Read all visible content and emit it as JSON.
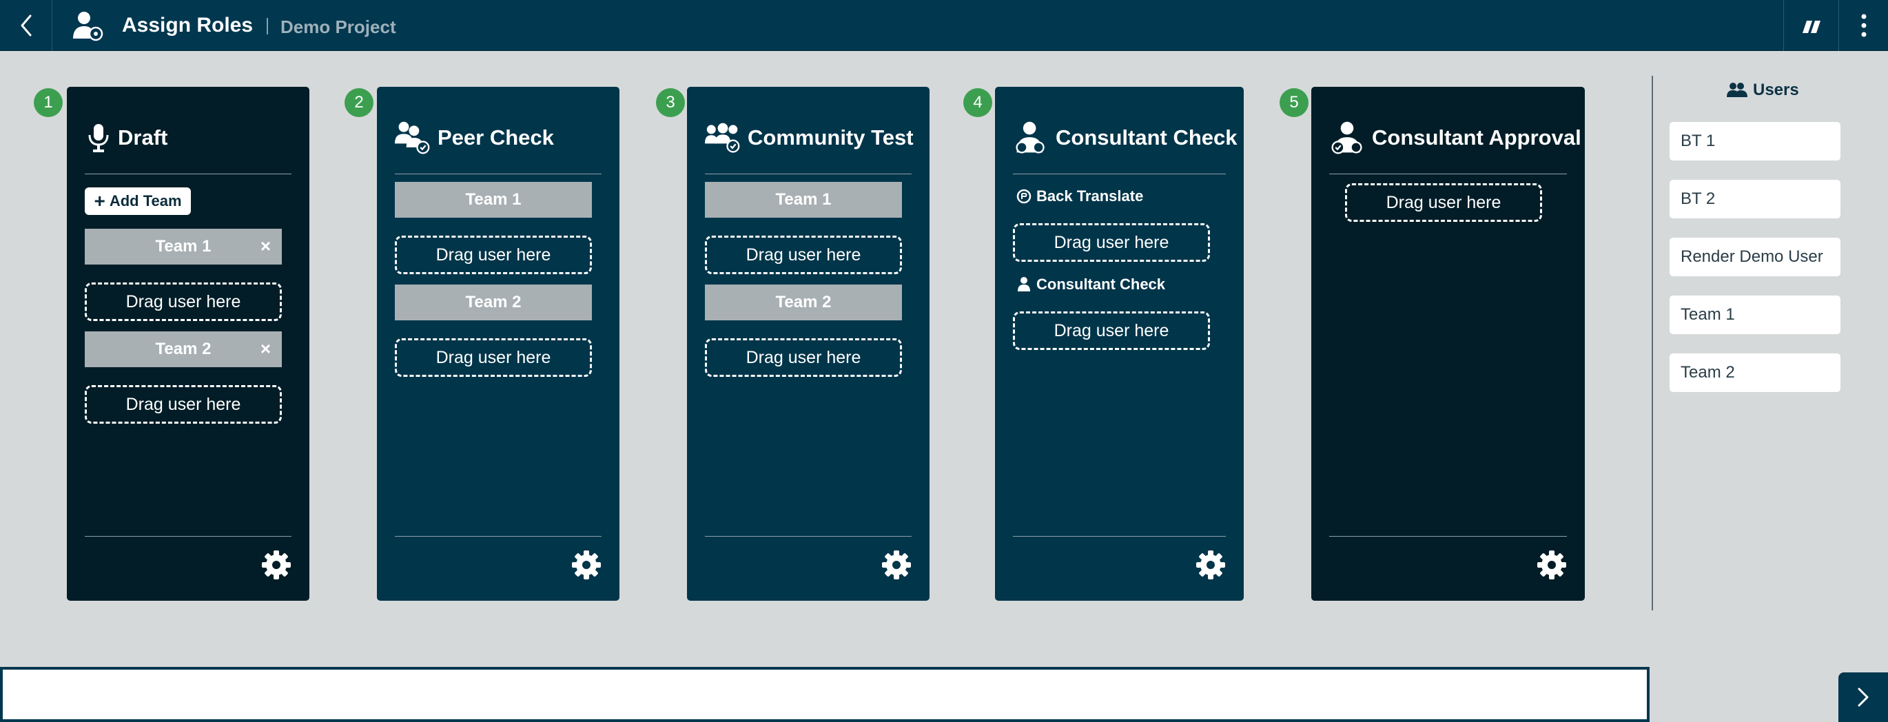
{
  "header": {
    "title": "Assign Roles",
    "project": "Demo Project",
    "back_icon": "chevron-left-icon",
    "title_icon": "user-gear-icon",
    "right_icons": [
      "quote-icon",
      "more-vertical-icon"
    ]
  },
  "colors": {
    "header_bg": "#01374f",
    "dark_column": "#021d27",
    "blue_column": "#01354a",
    "step_badge": "#3c9f50",
    "team_bar": "#a8b0b4",
    "page_bg": "#d6d9da"
  },
  "columns": [
    {
      "step": "1",
      "title": "Draft",
      "icon": "microphone-icon",
      "add_team_label": "Add Team",
      "teams": [
        {
          "name": "Team 1",
          "remove": "×",
          "drop": "Drag user here"
        },
        {
          "name": "Team 2",
          "remove": "×",
          "drop": "Drag user here"
        }
      ]
    },
    {
      "step": "2",
      "title": "Peer Check",
      "icon": "users-check-icon",
      "teams": [
        {
          "name": "Team 1",
          "drop": "Drag user here"
        },
        {
          "name": "Team 2",
          "drop": "Drag user here"
        }
      ]
    },
    {
      "step": "3",
      "title": "Community Test",
      "icon": "users-group-icon",
      "teams": [
        {
          "name": "Team 1",
          "drop": "Drag user here"
        },
        {
          "name": "Team 2",
          "drop": "Drag user here"
        }
      ]
    },
    {
      "step": "4",
      "title": "Consultant Check",
      "icon": "consultant-icon",
      "roles": [
        {
          "label": "Back Translate",
          "icon": "back-translate-icon",
          "drop": "Drag user here"
        },
        {
          "label": "Consultant Check",
          "icon": "consultant-small-icon",
          "drop": "Drag user here"
        }
      ]
    },
    {
      "step": "5",
      "title": "Consultant Approval",
      "icon": "consultant-approval-icon",
      "drop": "Drag user here"
    }
  ],
  "users_panel": {
    "title": "Users",
    "icon": "users-icon",
    "users": [
      "BT 1",
      "BT 2",
      "Render Demo User",
      "Team 1",
      "Team 2"
    ]
  },
  "footer": {
    "next_icon": "chevron-right-icon"
  }
}
